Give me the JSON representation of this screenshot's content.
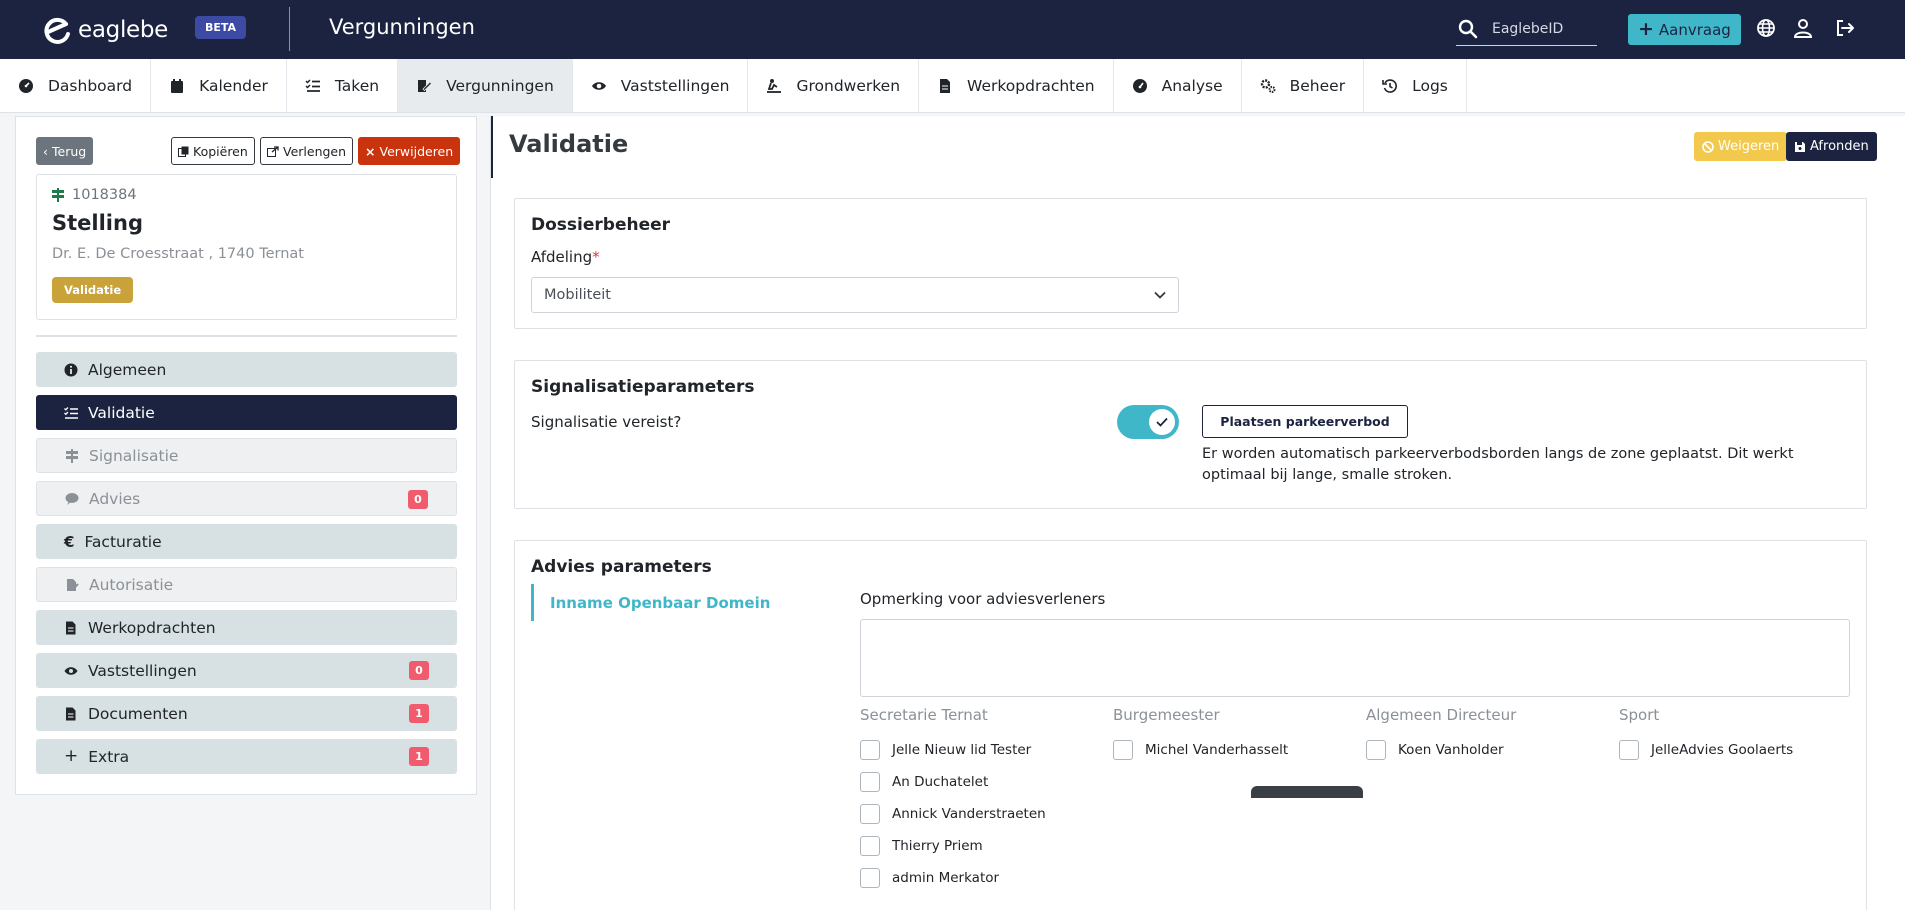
{
  "topbar": {
    "logo_text": "eaglebe",
    "beta_label": "BETA",
    "app_title": "Vergunningen",
    "search_placeholder": "EaglebeID",
    "aanvraag_label": "Aanvraag"
  },
  "nav": {
    "items": [
      {
        "label": "Dashboard",
        "icon": "dashboard-icon"
      },
      {
        "label": "Kalender",
        "icon": "calendar-icon"
      },
      {
        "label": "Taken",
        "icon": "tasks-icon"
      },
      {
        "label": "Vergunningen",
        "icon": "permit-icon",
        "active": true
      },
      {
        "label": "Vaststellingen",
        "icon": "eye-icon"
      },
      {
        "label": "Grondwerken",
        "icon": "digging-icon"
      },
      {
        "label": "Werkopdrachten",
        "icon": "file-icon"
      },
      {
        "label": "Analyse",
        "icon": "gauge-icon"
      },
      {
        "label": "Beheer",
        "icon": "cogs-icon"
      },
      {
        "label": "Logs",
        "icon": "history-icon"
      }
    ]
  },
  "left": {
    "terug_label": "Terug",
    "kopieren_label": "Kopiëren",
    "verlengen_label": "Verlengen",
    "verwijderen_label": "Verwijderen",
    "permit": {
      "id": "1018384",
      "title": "Stelling",
      "address": "Dr. E. De Croesstraat , 1740 Ternat",
      "status": "Validatie"
    },
    "menu": [
      {
        "label": "Algemeen",
        "state": "normal"
      },
      {
        "label": "Validatie",
        "state": "active"
      },
      {
        "label": "Signalisatie",
        "state": "disabled"
      },
      {
        "label": "Advies",
        "state": "disabled",
        "badge": "0"
      },
      {
        "label": "Facturatie",
        "state": "normal"
      },
      {
        "label": "Autorisatie",
        "state": "disabled"
      },
      {
        "label": "Werkopdrachten",
        "state": "normal"
      },
      {
        "label": "Vaststellingen",
        "state": "normal",
        "badge": "0"
      },
      {
        "label": "Documenten",
        "state": "normal",
        "badge": "1"
      },
      {
        "label": "Extra",
        "state": "normal",
        "badge": "1"
      }
    ]
  },
  "main": {
    "title": "Validatie",
    "weigeren_label": "Weigeren",
    "afronden_label": "Afronden",
    "dossier": {
      "title": "Dossierbeheer",
      "afdeling_label": "Afdeling",
      "required_mark": "*",
      "afdeling_value": "Mobiliteit"
    },
    "signalisatie": {
      "title": "Signalisatieparameters",
      "question": "Signalisatie vereist?",
      "toggle_on": true,
      "parkeer_button": "Plaatsen parkeerverbod",
      "parkeer_desc": "Er worden automatisch parkeerverbodsborden langs de zone geplaatst. Dit werkt optimaal bij lange, smalle stroken."
    },
    "advies": {
      "title": "Advies parameters",
      "tab_label": "Inname Openbaar Domein",
      "opmerking_label": "Opmerking voor adviesverleners",
      "groups": [
        {
          "title": "Secretarie Ternat",
          "members": [
            "Jelle Nieuw lid Tester",
            "An Duchatelet",
            "Annick Vanderstraeten",
            "Thierry Priem",
            "admin Merkator"
          ]
        },
        {
          "title": "Burgemeester",
          "members": [
            "Michel Vanderhasselt"
          ]
        },
        {
          "title": "Algemeen Directeur",
          "members": [
            "Koen Vanholder"
          ]
        },
        {
          "title": "Sport",
          "members": [
            "JelleAdvies Goolaerts"
          ]
        }
      ]
    }
  },
  "colors": {
    "navy": "#1c2340",
    "teal": "#3fb7c9",
    "danger": "#c9330d",
    "warning": "#f2c94c",
    "badge_red": "#f05c6d",
    "status_gold": "#c9a33a"
  }
}
